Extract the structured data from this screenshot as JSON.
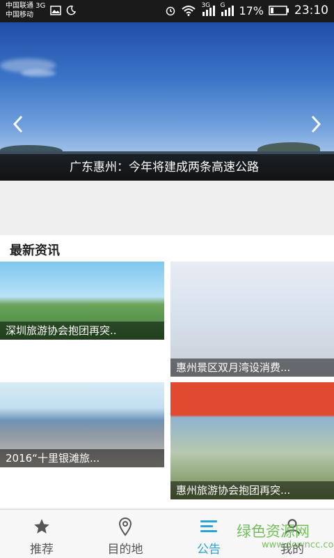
{
  "status_bar": {
    "carrier1": "中国联通 3G",
    "carrier2": "中国移动",
    "network_3g": "3G",
    "network_g": "G",
    "battery": "17%",
    "time": "23:10"
  },
  "banner": {
    "caption": "广东惠州：今年将建成两条高速公路",
    "prev_icon": "chevron-left-icon",
    "next_icon": "chevron-right-icon"
  },
  "news_section": {
    "title": "最新资讯",
    "items": [
      {
        "label": "深圳旅游协会抱团再突.."
      },
      {
        "label": "惠州景区双月湾设消费..."
      },
      {
        "label": "2016“十里银滩旅..."
      },
      {
        "label": "惠州旅游协会抱团再突..."
      }
    ]
  },
  "bottom_nav": {
    "items": [
      {
        "label": "推荐",
        "icon": "star-icon"
      },
      {
        "label": "目的地",
        "icon": "location-pin-icon"
      },
      {
        "label": "公告",
        "icon": "announcement-icon",
        "active": true
      },
      {
        "label": "我的",
        "icon": "person-icon"
      }
    ]
  },
  "watermark": {
    "text": "绿色资源网",
    "url": "www.downcc.com"
  },
  "colors": {
    "accent": "#29a3d8",
    "watermark": "#5db540"
  }
}
